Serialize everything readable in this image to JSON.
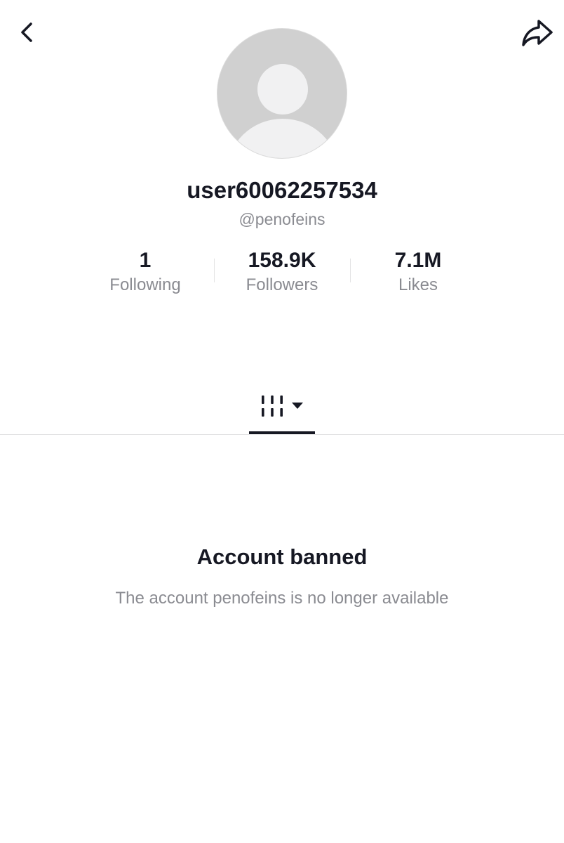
{
  "header": {
    "back_icon": "chevron-left-icon",
    "share_icon": "share-arrow-icon"
  },
  "profile": {
    "avatar_icon": "default-avatar-icon",
    "display_name": "user60062257534",
    "username": "@penofeins"
  },
  "stats": {
    "following": {
      "value": "1",
      "label": "Following"
    },
    "followers": {
      "value": "158.9K",
      "label": "Followers"
    },
    "likes": {
      "value": "7.1M",
      "label": "Likes"
    }
  },
  "tabs": {
    "videos_icon": "video-grid-icon",
    "dropdown_icon": "caret-down-icon"
  },
  "banned": {
    "title": "Account banned",
    "message": "The account penofeins is no longer available"
  },
  "colors": {
    "text_primary": "#161823",
    "text_secondary": "#8a8b91",
    "divider": "#e3e3e4",
    "avatar_bg": "#d0d0d0",
    "avatar_fg": "#f1f1f2"
  }
}
